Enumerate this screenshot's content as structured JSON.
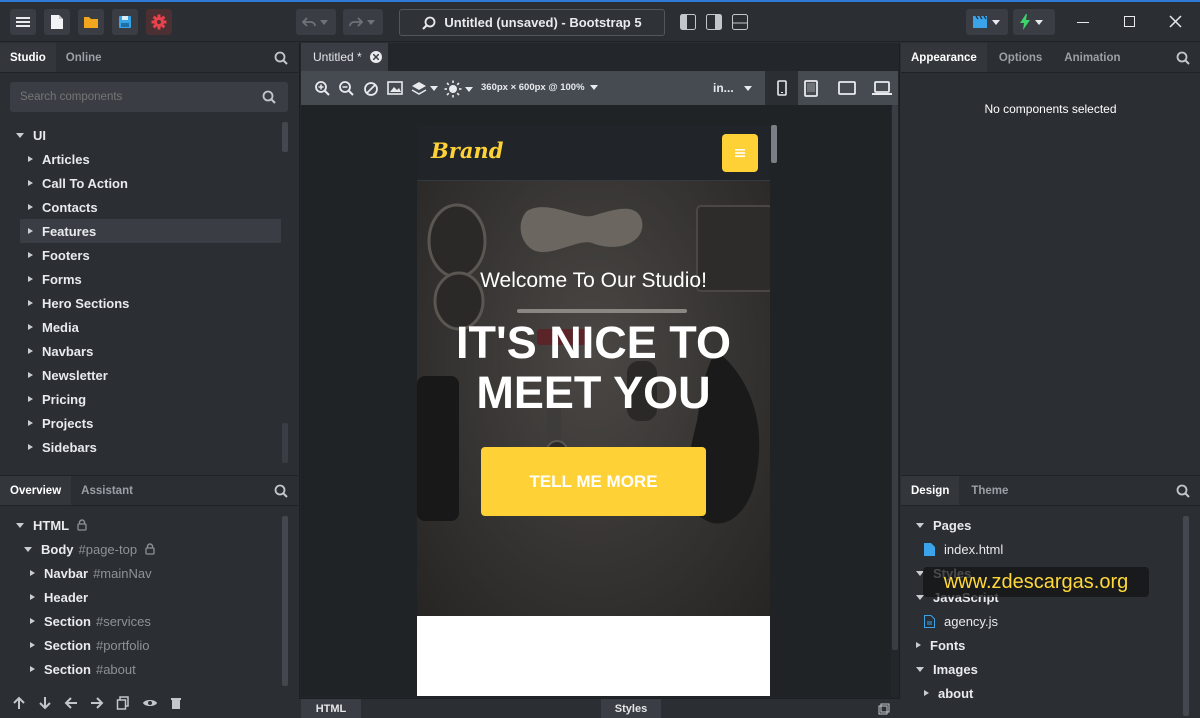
{
  "window": {
    "title": "Untitled (unsaved) - Bootstrap 5"
  },
  "left_panel": {
    "tabs": [
      "Studio",
      "Online"
    ],
    "search_placeholder": "Search components",
    "root": "UI",
    "categories": [
      "Articles",
      "Call To Action",
      "Contacts",
      "Features",
      "Footers",
      "Forms",
      "Hero Sections",
      "Media",
      "Navbars",
      "Newsletter",
      "Pricing",
      "Projects",
      "Sidebars"
    ],
    "selected_category": "Features"
  },
  "overview_panel": {
    "tabs": [
      "Overview",
      "Assistant"
    ],
    "tree": [
      {
        "label": "HTML",
        "suffix": "",
        "lock": true
      },
      {
        "label": "Body",
        "suffix": "#page-top",
        "lock": true
      },
      {
        "label": "Navbar",
        "suffix": "#mainNav",
        "lock": false
      },
      {
        "label": "Header",
        "suffix": "",
        "lock": false
      },
      {
        "label": "Section",
        "suffix": "#services",
        "lock": false
      },
      {
        "label": "Section",
        "suffix": "#portfolio",
        "lock": false
      },
      {
        "label": "Section",
        "suffix": "#about",
        "lock": false
      }
    ]
  },
  "editor": {
    "tab_label": "Untitled *",
    "viewport_label": "360px × 600px @ 100%",
    "breakpoint_label": "in...",
    "bottom_tabs": [
      "HTML",
      "Styles"
    ]
  },
  "preview": {
    "brand": "Brand",
    "subheading": "Welcome To Our Studio!",
    "heading_line1": "IT'S NICE TO",
    "heading_line2": "MEET YOU",
    "cta": "TELL ME MORE",
    "accent": "#ffc931"
  },
  "right_panel": {
    "tabs": [
      "Appearance",
      "Options",
      "Animation"
    ],
    "empty_message": "No components selected"
  },
  "design_panel": {
    "tabs": [
      "Design",
      "Theme"
    ],
    "tree": [
      {
        "label": "Pages",
        "type": "folder-open"
      },
      {
        "label": "index.html",
        "type": "file"
      },
      {
        "label": "Styles",
        "type": "folder-open"
      },
      {
        "label": "JavaScript",
        "type": "folder-open"
      },
      {
        "label": "agency.js",
        "type": "script"
      },
      {
        "label": "Fonts",
        "type": "folder"
      },
      {
        "label": "Images",
        "type": "folder-open"
      },
      {
        "label": "about",
        "type": "folder"
      }
    ]
  },
  "watermark": "www.zdescargas.org"
}
